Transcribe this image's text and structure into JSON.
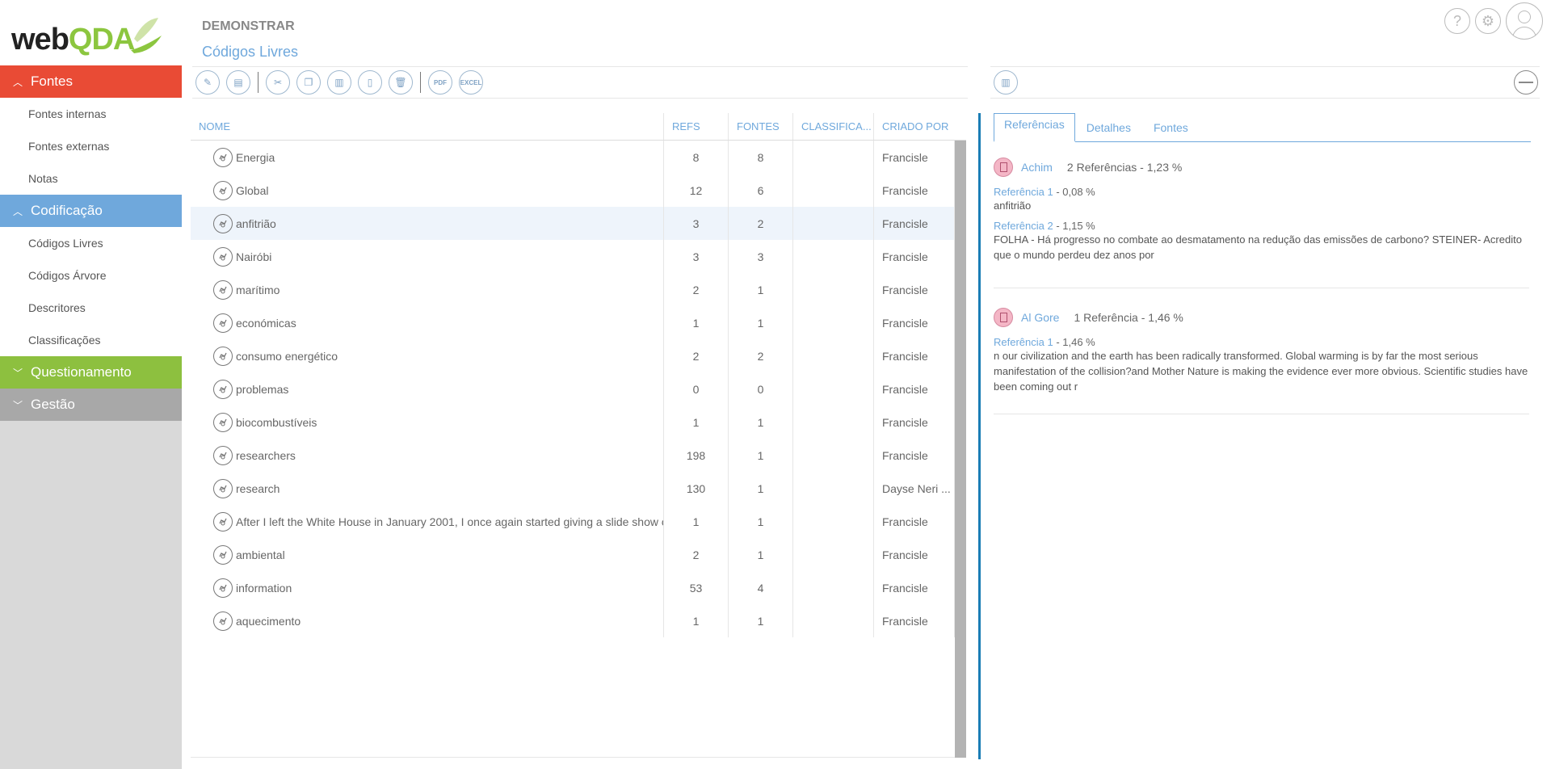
{
  "app": {
    "logo_web": "web",
    "logo_qda": "QDA"
  },
  "sidebar": {
    "sections": [
      {
        "label": "Fontes",
        "items": [
          "Fontes internas",
          "Fontes externas",
          "Notas"
        ]
      },
      {
        "label": "Codificação",
        "items": [
          "Códigos Livres",
          "Códigos Árvore",
          "Descritores",
          "Classificações"
        ]
      },
      {
        "label": "Questionamento",
        "items": []
      },
      {
        "label": "Gestão",
        "items": []
      }
    ]
  },
  "header": {
    "project": "DEMONSTRAR",
    "subtitle": "Códigos Livres"
  },
  "top_icons": {
    "help": "?",
    "settings": "⚙"
  },
  "toolbar": {
    "pdf": "PDF",
    "excel": "EXCEL"
  },
  "table": {
    "columns": {
      "nome": "NOME",
      "refs": "REFS",
      "fontes": "FONTES",
      "class": "CLASSIFICA...",
      "criado": "CRIADO POR"
    },
    "rows": [
      {
        "nome": "Energia",
        "refs": "8",
        "fontes": "8",
        "class": "",
        "criado": "Francisle"
      },
      {
        "nome": "Global",
        "refs": "12",
        "fontes": "6",
        "class": "",
        "criado": "Francisle"
      },
      {
        "nome": "anfitrião",
        "refs": "3",
        "fontes": "2",
        "class": "",
        "criado": "Francisle"
      },
      {
        "nome": "Nairóbi",
        "refs": "3",
        "fontes": "3",
        "class": "",
        "criado": "Francisle"
      },
      {
        "nome": "marítimo",
        "refs": "2",
        "fontes": "1",
        "class": "",
        "criado": "Francisle"
      },
      {
        "nome": "económicas",
        "refs": "1",
        "fontes": "1",
        "class": "",
        "criado": "Francisle"
      },
      {
        "nome": "consumo energético",
        "refs": "2",
        "fontes": "2",
        "class": "",
        "criado": "Francisle"
      },
      {
        "nome": "problemas",
        "refs": "0",
        "fontes": "0",
        "class": "",
        "criado": "Francisle"
      },
      {
        "nome": "biocombustíveis",
        "refs": "1",
        "fontes": "1",
        "class": "",
        "criado": "Francisle"
      },
      {
        "nome": "researchers",
        "refs": "198",
        "fontes": "1",
        "class": "",
        "criado": "Francisle"
      },
      {
        "nome": "research",
        "refs": "130",
        "fontes": "1",
        "class": "",
        "criado": "Dayse Neri ..."
      },
      {
        "nome": "After I left the White House in January 2001, I once again started giving a slide show o",
        "refs": "1",
        "fontes": "1",
        "class": "",
        "criado": "Francisle"
      },
      {
        "nome": "ambiental",
        "refs": "2",
        "fontes": "1",
        "class": "",
        "criado": "Francisle"
      },
      {
        "nome": "information",
        "refs": "53",
        "fontes": "4",
        "class": "",
        "criado": "Francisle"
      },
      {
        "nome": "aquecimento",
        "refs": "1",
        "fontes": "1",
        "class": "",
        "criado": "Francisle"
      }
    ]
  },
  "panel": {
    "tabs": [
      "Referências",
      "Detalhes",
      "Fontes"
    ],
    "sources": [
      {
        "name": "Achim",
        "count": "2 Referências - 1,23 %",
        "refs": [
          {
            "label": "Referência 1",
            "pct": " - 0,08 %",
            "text": "anfitrião"
          },
          {
            "label": "Referência 2",
            "pct": " - 1,15 %",
            "text": "FOLHA - Há progresso no combate ao desmatamento na redução das emissões de carbono? STEINER- Acredito que o mundo perdeu dez anos por"
          }
        ]
      },
      {
        "name": "Al Gore",
        "count": "1 Referência - 1,46 %",
        "refs": [
          {
            "label": "Referência 1",
            "pct": " - 1,46 %",
            "text": "n our civilization and the earth has been radically transformed. Global warming is by far the most serious manifestation of the collision?and Mother Nature is making the evidence ever more obvious. Scientific studies have been coming out r"
          }
        ]
      }
    ]
  }
}
